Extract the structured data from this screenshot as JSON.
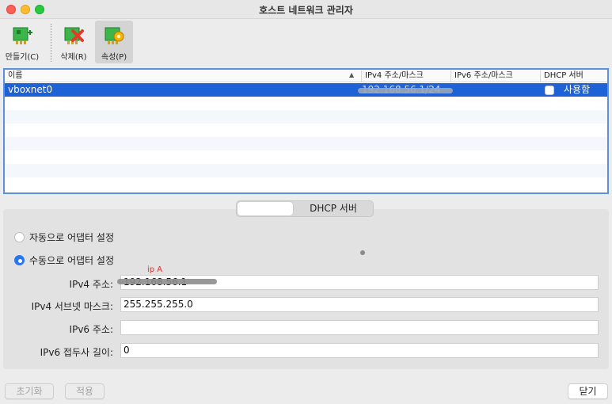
{
  "window": {
    "title": "호스트 네트워크 관리자"
  },
  "toolbar": {
    "create_label": "만들기(C)",
    "delete_label": "삭제(R)",
    "properties_label": "속성(P)"
  },
  "table": {
    "columns": [
      "이름",
      "IPv4 주소/마스크",
      "IPv6 주소/마스크",
      "DHCP 서버"
    ],
    "sort_indicator": "▲",
    "rows": [
      {
        "name": "vboxnet0",
        "ipv4": "192.168.56.1/24",
        "ipv6": "",
        "dhcp_label": "사용함",
        "dhcp_checked": false
      }
    ]
  },
  "tabs": {
    "first": "",
    "second": "DHCP 서버"
  },
  "adapter": {
    "auto_label": "자동으로 어댑터 설정",
    "manual_label": "수동으로 어댑터 설정",
    "mode": "manual"
  },
  "annotation": "ip A",
  "form": {
    "ipv4_label": "IPv4 주소:",
    "ipv4_value": "192.168.56.1",
    "mask_label": "IPv4 서브넷 마스크:",
    "mask_value": "255.255.255.0",
    "ipv6_label": "IPv6 주소:",
    "ipv6_value": "",
    "prefix_label": "IPv6 접두사 길이:",
    "prefix_value": "0"
  },
  "buttons": {
    "reset": "초기화",
    "apply": "적용",
    "close": "닫기"
  },
  "colors": {
    "selection": "#1f62d6",
    "radio_on": "#2a75ef",
    "annotation": "#e03030"
  }
}
